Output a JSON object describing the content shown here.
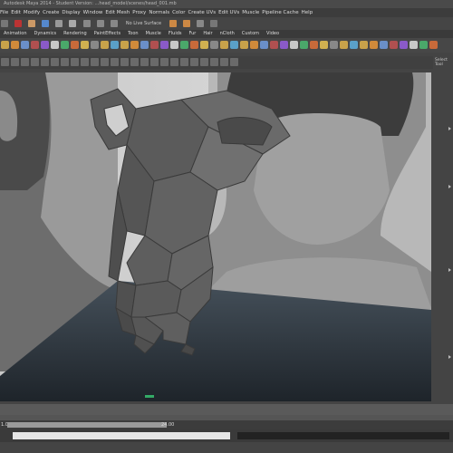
{
  "title": "Autodesk Maya 2014 - Student Version: ...head_model/scenes/head_001.mb",
  "menus": [
    "File",
    "Edit",
    "Modify",
    "Create",
    "Display",
    "Window",
    "Edit Mesh",
    "Proxy",
    "Normals",
    "Color",
    "Create UVs",
    "Edit UVs",
    "Muscle",
    "Pipeline Cache",
    "Help"
  ],
  "status_line": {
    "mode_text": "No Live Surface"
  },
  "shelf_tabs": [
    "Animation",
    "Dynamics",
    "Rendering",
    "PaintEffects",
    "Toon",
    "Muscle",
    "Fluids",
    "Fur",
    "Hair",
    "nCloth",
    "Custom",
    "Video"
  ],
  "right_panel": {
    "label": "Select Tool"
  },
  "range": {
    "start": "1.00",
    "end": "24.00"
  },
  "colors": {
    "bg": "#444444",
    "menubar": "#3c3c3c",
    "viewport_bg": "#dcdcdc",
    "floor": "#2f3841",
    "mesh": "#5a5a5a",
    "accent": "#f0b000"
  }
}
